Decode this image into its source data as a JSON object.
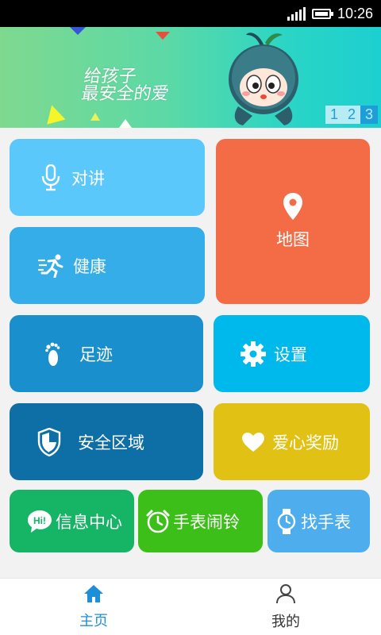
{
  "status_bar": {
    "time": "10:26"
  },
  "banner": {
    "slogan_line1": "给孩子",
    "slogan_line2": "最安全的爱",
    "pages": [
      "1",
      "2",
      "3"
    ],
    "active_page": "3"
  },
  "tiles": {
    "intercom": {
      "label": "对讲",
      "color": "#5ac8fa"
    },
    "map": {
      "label": "地图",
      "color": "#f46c45"
    },
    "health": {
      "label": "健康",
      "color": "#34ade8"
    },
    "footprint": {
      "label": "足迹",
      "color": "#1a8fce"
    },
    "settings": {
      "label": "设置",
      "color": "#00b9ec"
    },
    "safe_zone": {
      "label": "安全区域",
      "color": "#0d6fa6"
    },
    "love_reward": {
      "label": "爱心奖励",
      "color": "#e1c113"
    },
    "message_center": {
      "label": "信息中心",
      "color": "#16b566"
    },
    "watch_alarm": {
      "label": "手表闹铃",
      "color": "#3cbf18"
    },
    "find_watch": {
      "label": "找手表",
      "color": "#4eaded"
    }
  },
  "bottom_nav": {
    "home": {
      "label": "主页",
      "color": "#1d8fd8"
    },
    "mine": {
      "label": "我的",
      "color": "#333333"
    }
  }
}
